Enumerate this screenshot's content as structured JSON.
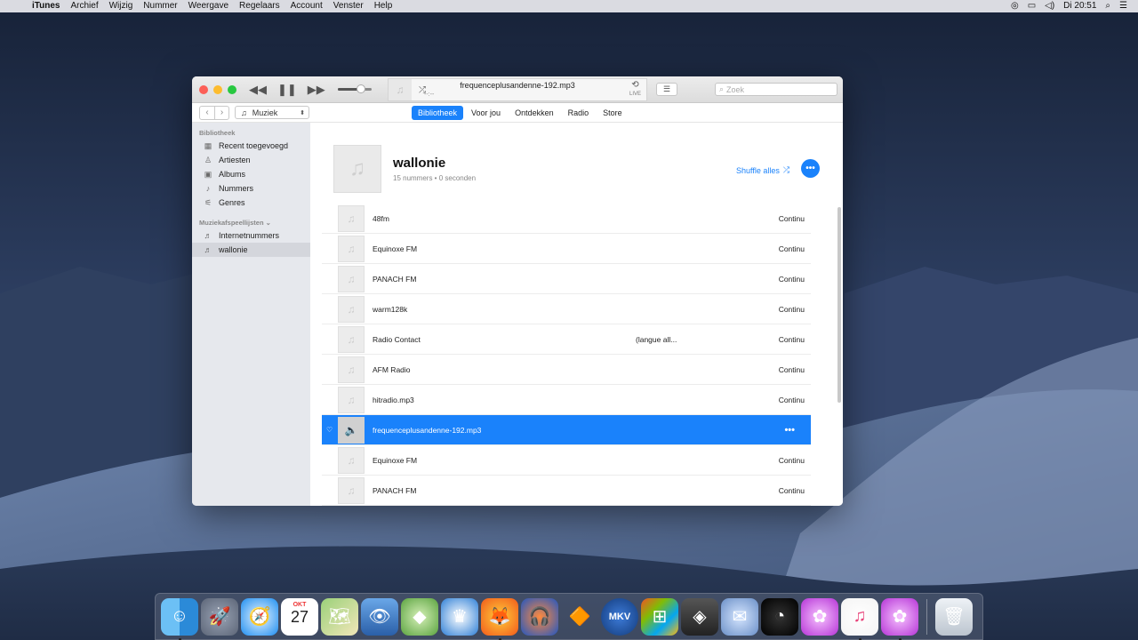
{
  "menubar": {
    "app": "iTunes",
    "items": [
      "Archief",
      "Wijzig",
      "Nummer",
      "Weergave",
      "Regelaars",
      "Account",
      "Venster",
      "Help"
    ],
    "clock": "Di 20:51"
  },
  "player": {
    "now_playing": "frequenceplusandenne-192.mp3",
    "time": "--:--",
    "repeat_label": "LIVE",
    "volume_level": 0.7,
    "search_placeholder": "Zoek"
  },
  "navbar": {
    "media": "Muziek",
    "tabs": [
      {
        "label": "Bibliotheek",
        "active": true
      },
      {
        "label": "Voor jou",
        "active": false
      },
      {
        "label": "Ontdekken",
        "active": false
      },
      {
        "label": "Radio",
        "active": false
      },
      {
        "label": "Store",
        "active": false
      }
    ]
  },
  "sidebar": {
    "library_title": "Bibliotheek",
    "library_items": [
      {
        "label": "Recent toegevoegd",
        "icon": "recent-icon"
      },
      {
        "label": "Artiesten",
        "icon": "artists-icon"
      },
      {
        "label": "Albums",
        "icon": "albums-icon"
      },
      {
        "label": "Nummers",
        "icon": "songs-icon"
      },
      {
        "label": "Genres",
        "icon": "genres-icon"
      }
    ],
    "playlists_title": "Muziekafspeellijsten",
    "playlists": [
      {
        "label": "Internetnummers",
        "selected": false
      },
      {
        "label": "wallonie",
        "selected": true
      }
    ]
  },
  "playlist": {
    "title": "wallonie",
    "meta": "15 nummers • 0 seconden",
    "shuffle_label": "Shuffle alles",
    "tracks": [
      {
        "name": "48fm",
        "note": "",
        "status": "Continu"
      },
      {
        "name": "Equinoxe FM",
        "note": "",
        "status": "Continu"
      },
      {
        "name": "PANACH FM",
        "note": "",
        "status": "Continu"
      },
      {
        "name": "warm128k",
        "note": "",
        "status": "Continu"
      },
      {
        "name": "Radio Contact",
        "note": "(langue all...",
        "status": "Continu"
      },
      {
        "name": "AFM Radio",
        "note": "",
        "status": "Continu"
      },
      {
        "name": "hitradio.mp3",
        "note": "",
        "status": "Continu"
      },
      {
        "name": "frequenceplusandenne-192.mp3",
        "note": "",
        "status": "",
        "playing": true
      },
      {
        "name": "Equinoxe FM",
        "note": "",
        "status": "Continu"
      },
      {
        "name": "PANACH FM",
        "note": "",
        "status": "Continu"
      }
    ]
  },
  "dock": {
    "calendar_month": "OKT",
    "calendar_day": "27",
    "apps": [
      "finder",
      "launchpad",
      "safari",
      "calendar",
      "maps",
      "preview",
      "sims",
      "chess",
      "firefox",
      "audacity",
      "vlc",
      "mkv",
      "windows",
      "parallels",
      "bluetooth",
      "speedometer",
      "flower",
      "itunes",
      "flower2",
      "trash"
    ]
  },
  "colors": {
    "accent": "#1a82fb"
  }
}
